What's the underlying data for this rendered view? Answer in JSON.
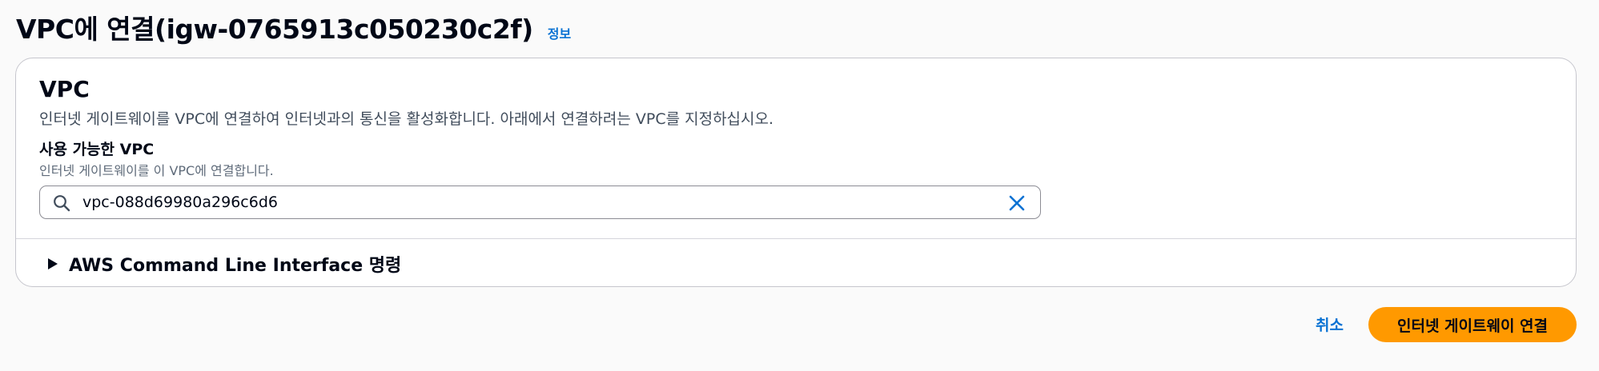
{
  "header": {
    "title": "VPC에 연결(igw-0765913c050230c2f)",
    "info_link": "정보"
  },
  "panel": {
    "title": "VPC",
    "description": "인터넷 게이트웨이를 VPC에 연결하여 인터넷과의 통신을 활성화합니다. 아래에서 연결하려는 VPC를 지정하십시오.",
    "field": {
      "label": "사용 가능한 VPC",
      "description": "인터넷 게이트웨이를 이 VPC에 연결합니다.",
      "value": "vpc-088d69980a296c6d6",
      "search_icon": "search-icon",
      "clear_icon": "close-icon"
    },
    "cli_expander": {
      "label": "AWS Command Line Interface 명령",
      "icon": "caret-right-icon"
    }
  },
  "footer": {
    "cancel_label": "취소",
    "submit_label": "인터넷 게이트웨이 연결"
  },
  "colors": {
    "primary": "#ff9900",
    "link": "#0972d3",
    "text": "#000716",
    "background": "#fafafa"
  }
}
